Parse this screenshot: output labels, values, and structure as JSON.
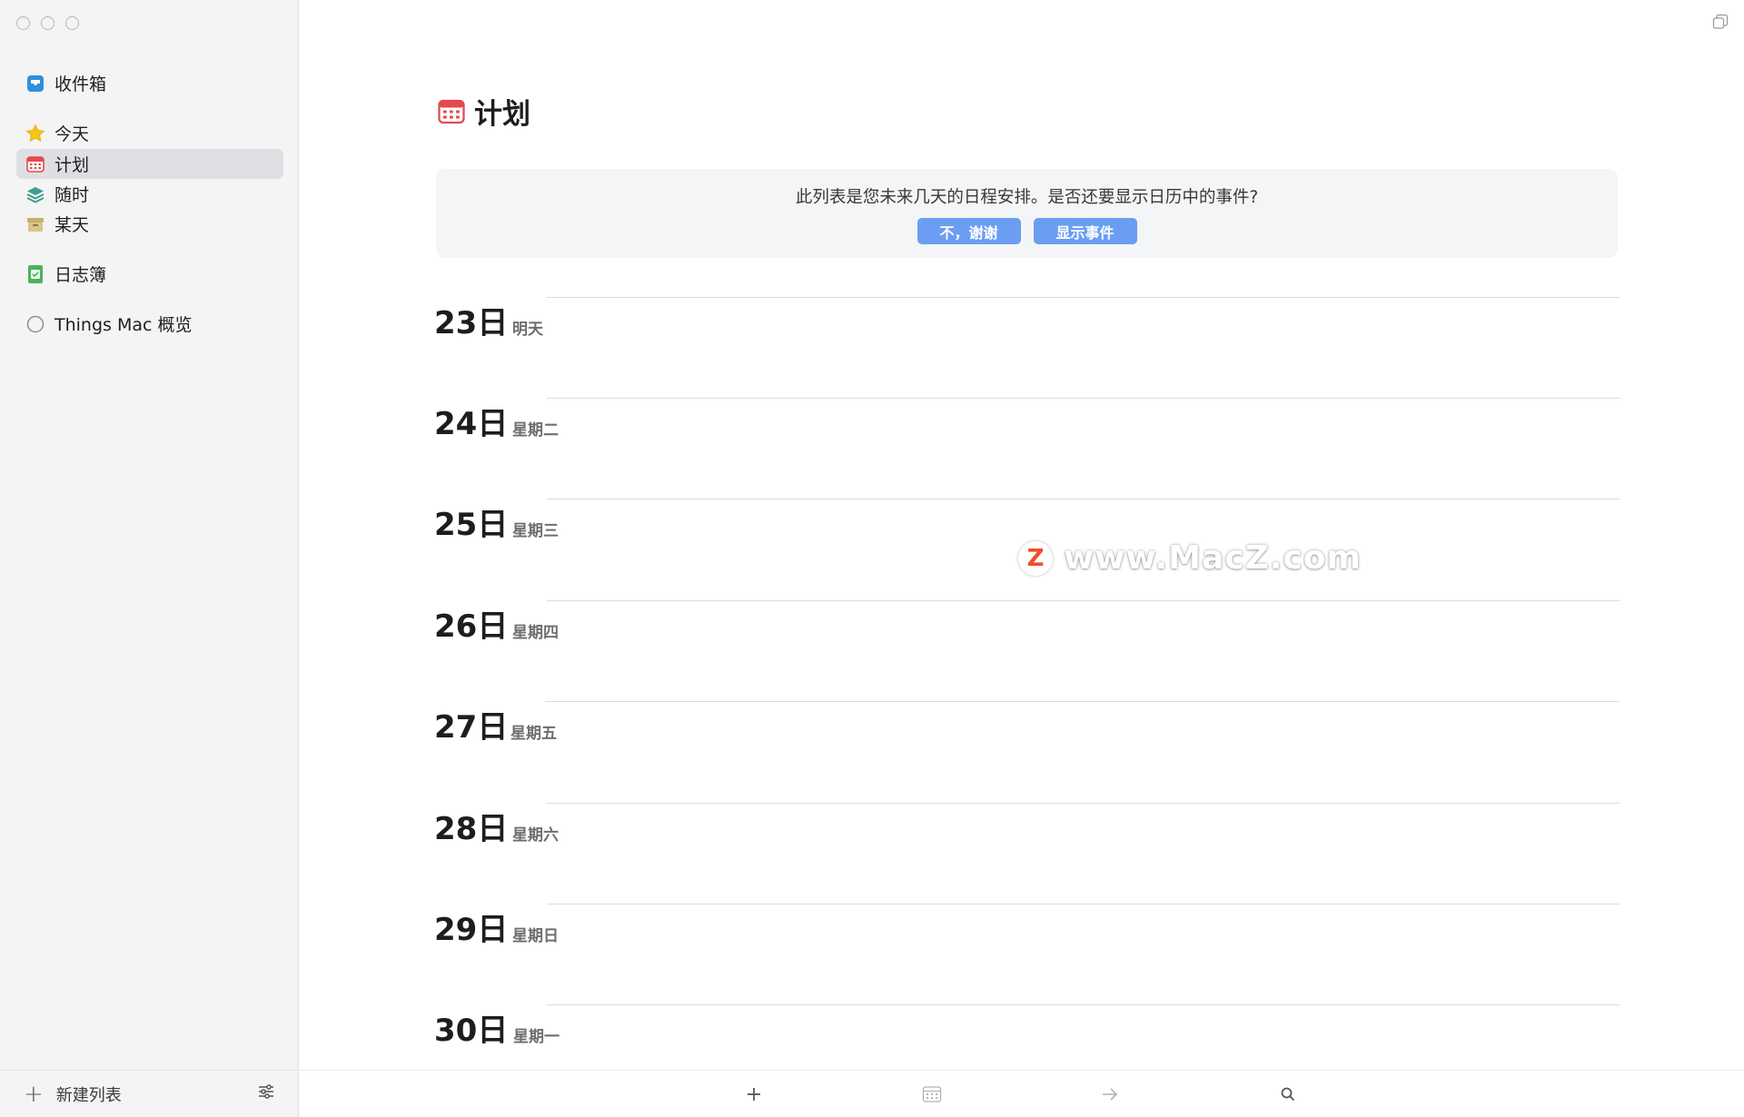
{
  "sidebar": {
    "items": [
      {
        "label": "收件箱",
        "icon": "inbox-icon"
      },
      {
        "label": "今天",
        "icon": "star-icon"
      },
      {
        "label": "计划",
        "icon": "calendar-icon"
      },
      {
        "label": "随时",
        "icon": "layers-icon"
      },
      {
        "label": "某天",
        "icon": "archive-box-icon"
      },
      {
        "label": "日志簿",
        "icon": "logbook-icon"
      },
      {
        "label": "Things Mac 概览",
        "icon": "circle-checkbox-icon"
      }
    ],
    "footer": {
      "new_list_label": "新建列表"
    }
  },
  "main": {
    "title": "计划",
    "prompt": {
      "text": "此列表是您未来几天的日程安排。是否还要显示日历中的事件?",
      "no_label": "不，谢谢",
      "show_label": "显示事件"
    },
    "days": [
      {
        "num": "23日",
        "weekday": "明天"
      },
      {
        "num": "24日",
        "weekday": "星期二"
      },
      {
        "num": "25日",
        "weekday": "星期三"
      },
      {
        "num": "26日",
        "weekday": "星期四"
      },
      {
        "num": "27日",
        "weekday": "星期五"
      },
      {
        "num": "28日",
        "weekday": "星期六"
      },
      {
        "num": "29日",
        "weekday": "星期日"
      },
      {
        "num": "30日",
        "weekday": "星期一"
      }
    ],
    "watermark": "www.MacZ.com",
    "watermark_logo": "Z"
  },
  "colors": {
    "accent_button": "#6b9ef2",
    "calendar_red": "#e5484d",
    "star_yellow": "#f5c518",
    "layers_teal": "#3f9e8f",
    "archive_tan": "#c8ae6a",
    "logbook_green": "#4cb35a",
    "inbox_blue": "#2f8fdc"
  }
}
